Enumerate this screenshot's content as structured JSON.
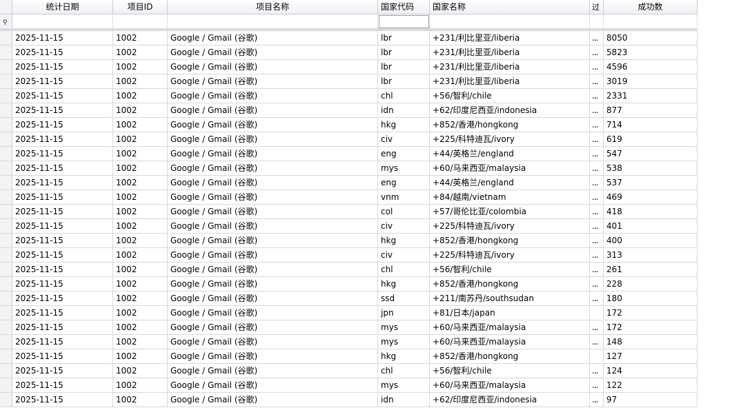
{
  "columns": [
    {
      "key": "date",
      "label": "统计日期"
    },
    {
      "key": "project_id",
      "label": "项目ID"
    },
    {
      "key": "project_name",
      "label": "项目名称"
    },
    {
      "key": "country_code",
      "label": "国家代码"
    },
    {
      "key": "country_name",
      "label": "国家名称"
    },
    {
      "key": "truncated",
      "label": "过"
    },
    {
      "key": "success_count",
      "label": "成功数"
    }
  ],
  "filter_row_icon": "pin-icon",
  "truncated_text": "...",
  "rows": [
    {
      "date": "2025-11-15",
      "project_id": "1002",
      "project_name": "Google / Gmail (谷歌)",
      "country_code": "lbr",
      "country_name": "+231/利比里亚/liberia",
      "truncated": "...",
      "success_count": "8050"
    },
    {
      "date": "2025-11-15",
      "project_id": "1002",
      "project_name": "Google / Gmail (谷歌)",
      "country_code": "lbr",
      "country_name": "+231/利比里亚/liberia",
      "truncated": "...",
      "success_count": "5823"
    },
    {
      "date": "2025-11-15",
      "project_id": "1002",
      "project_name": "Google / Gmail (谷歌)",
      "country_code": "lbr",
      "country_name": "+231/利比里亚/liberia",
      "truncated": "...",
      "success_count": "4596"
    },
    {
      "date": "2025-11-15",
      "project_id": "1002",
      "project_name": "Google / Gmail (谷歌)",
      "country_code": "lbr",
      "country_name": "+231/利比里亚/liberia",
      "truncated": "...",
      "success_count": "3019"
    },
    {
      "date": "2025-11-15",
      "project_id": "1002",
      "project_name": "Google / Gmail (谷歌)",
      "country_code": "chl",
      "country_name": "+56/智利/chile",
      "truncated": "...",
      "success_count": "2331"
    },
    {
      "date": "2025-11-15",
      "project_id": "1002",
      "project_name": "Google / Gmail (谷歌)",
      "country_code": "idn",
      "country_name": "+62/印度尼西亚/indonesia",
      "truncated": "...",
      "success_count": "877"
    },
    {
      "date": "2025-11-15",
      "project_id": "1002",
      "project_name": "Google / Gmail (谷歌)",
      "country_code": "hkg",
      "country_name": "+852/香港/hongkong",
      "truncated": "...",
      "success_count": "714"
    },
    {
      "date": "2025-11-15",
      "project_id": "1002",
      "project_name": "Google / Gmail (谷歌)",
      "country_code": "civ",
      "country_name": "+225/科特迪瓦/ivory",
      "truncated": "...",
      "success_count": "619"
    },
    {
      "date": "2025-11-15",
      "project_id": "1002",
      "project_name": "Google / Gmail (谷歌)",
      "country_code": "eng",
      "country_name": "+44/英格兰/england",
      "truncated": "...",
      "success_count": "547"
    },
    {
      "date": "2025-11-15",
      "project_id": "1002",
      "project_name": "Google / Gmail (谷歌)",
      "country_code": "mys",
      "country_name": "+60/马来西亚/malaysia",
      "truncated": "...",
      "success_count": "538"
    },
    {
      "date": "2025-11-15",
      "project_id": "1002",
      "project_name": "Google / Gmail (谷歌)",
      "country_code": "eng",
      "country_name": "+44/英格兰/england",
      "truncated": "...",
      "success_count": "537"
    },
    {
      "date": "2025-11-15",
      "project_id": "1002",
      "project_name": "Google / Gmail (谷歌)",
      "country_code": "vnm",
      "country_name": "+84/越南/vietnam",
      "truncated": "...",
      "success_count": "469"
    },
    {
      "date": "2025-11-15",
      "project_id": "1002",
      "project_name": "Google / Gmail (谷歌)",
      "country_code": "col",
      "country_name": "+57/哥伦比亚/colombia",
      "truncated": "...",
      "success_count": "418"
    },
    {
      "date": "2025-11-15",
      "project_id": "1002",
      "project_name": "Google / Gmail (谷歌)",
      "country_code": "civ",
      "country_name": "+225/科特迪瓦/ivory",
      "truncated": "...",
      "success_count": "401"
    },
    {
      "date": "2025-11-15",
      "project_id": "1002",
      "project_name": "Google / Gmail (谷歌)",
      "country_code": "hkg",
      "country_name": "+852/香港/hongkong",
      "truncated": "...",
      "success_count": "400"
    },
    {
      "date": "2025-11-15",
      "project_id": "1002",
      "project_name": "Google / Gmail (谷歌)",
      "country_code": "civ",
      "country_name": "+225/科特迪瓦/ivory",
      "truncated": "...",
      "success_count": "313"
    },
    {
      "date": "2025-11-15",
      "project_id": "1002",
      "project_name": "Google / Gmail (谷歌)",
      "country_code": "chl",
      "country_name": "+56/智利/chile",
      "truncated": "...",
      "success_count": "261"
    },
    {
      "date": "2025-11-15",
      "project_id": "1002",
      "project_name": "Google / Gmail (谷歌)",
      "country_code": "hkg",
      "country_name": "+852/香港/hongkong",
      "truncated": "...",
      "success_count": "228"
    },
    {
      "date": "2025-11-15",
      "project_id": "1002",
      "project_name": "Google / Gmail (谷歌)",
      "country_code": "ssd",
      "country_name": "+211/南苏丹/southsudan",
      "truncated": "...",
      "success_count": "180"
    },
    {
      "date": "2025-11-15",
      "project_id": "1002",
      "project_name": "Google / Gmail (谷歌)",
      "country_code": "jpn",
      "country_name": "+81/日本/japan",
      "truncated": "",
      "success_count": "172"
    },
    {
      "date": "2025-11-15",
      "project_id": "1002",
      "project_name": "Google / Gmail (谷歌)",
      "country_code": "mys",
      "country_name": "+60/马来西亚/malaysia",
      "truncated": "...",
      "success_count": "172"
    },
    {
      "date": "2025-11-15",
      "project_id": "1002",
      "project_name": "Google / Gmail (谷歌)",
      "country_code": "mys",
      "country_name": "+60/马来西亚/malaysia",
      "truncated": "...",
      "success_count": "148"
    },
    {
      "date": "2025-11-15",
      "project_id": "1002",
      "project_name": "Google / Gmail (谷歌)",
      "country_code": "hkg",
      "country_name": "+852/香港/hongkong",
      "truncated": "",
      "success_count": "127"
    },
    {
      "date": "2025-11-15",
      "project_id": "1002",
      "project_name": "Google / Gmail (谷歌)",
      "country_code": "chl",
      "country_name": "+56/智利/chile",
      "truncated": "...",
      "success_count": "124"
    },
    {
      "date": "2025-11-15",
      "project_id": "1002",
      "project_name": "Google / Gmail (谷歌)",
      "country_code": "mys",
      "country_name": "+60/马来西亚/malaysia",
      "truncated": "...",
      "success_count": "122"
    },
    {
      "date": "2025-11-15",
      "project_id": "1002",
      "project_name": "Google / Gmail (谷歌)",
      "country_code": "idn",
      "country_name": "+62/印度尼西亚/indonesia",
      "truncated": "...",
      "success_count": "97"
    }
  ]
}
